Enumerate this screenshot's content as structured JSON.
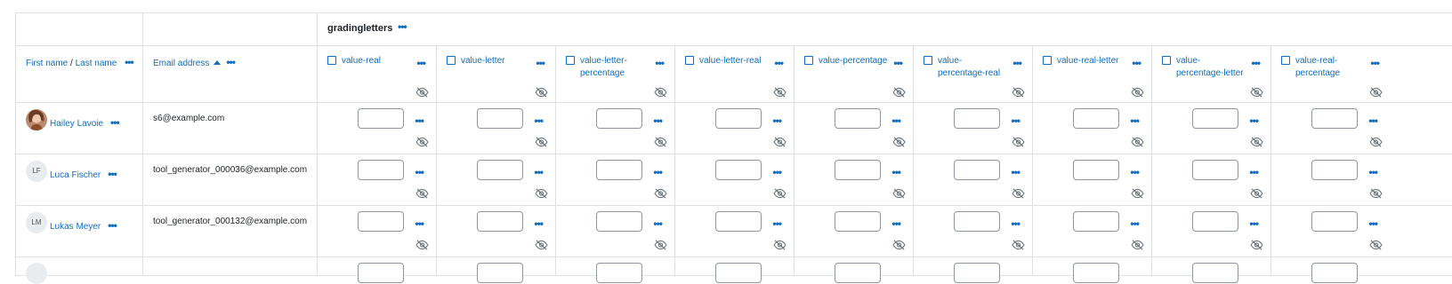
{
  "category": {
    "name": "gradingletters"
  },
  "headers": {
    "first_name": "First name",
    "separator": " / ",
    "last_name": "Last name",
    "email": "Email address"
  },
  "columns": [
    {
      "title": "value-real"
    },
    {
      "title": "value-letter"
    },
    {
      "title": "value-letter-percentage"
    },
    {
      "title": "value-letter-real"
    },
    {
      "title": "value-percentage"
    },
    {
      "title": "value-percentage-real"
    },
    {
      "title": "value-real-letter"
    },
    {
      "title": "value-percentage-letter"
    },
    {
      "title": "value-real-percentage"
    }
  ],
  "users": [
    {
      "name": "Hailey Lavoie",
      "email": "s6@example.com",
      "avatar": "photo",
      "initials": ""
    },
    {
      "name": "Luca Fischer",
      "email": "tool_generator_000036@example.com",
      "avatar": "initials",
      "initials": "LF"
    },
    {
      "name": "Lukas Meyer",
      "email": "tool_generator_000132@example.com",
      "avatar": "initials",
      "initials": "LM"
    }
  ],
  "icons": {
    "menu": "ellipsis-icon",
    "hide": "eye-slash-icon",
    "sort": "sort-ascending-icon",
    "select": "checkbox-icon"
  },
  "colors": {
    "link": "#0f6cbf",
    "border": "#dee2e6",
    "icon_gray": "#6a737b"
  }
}
